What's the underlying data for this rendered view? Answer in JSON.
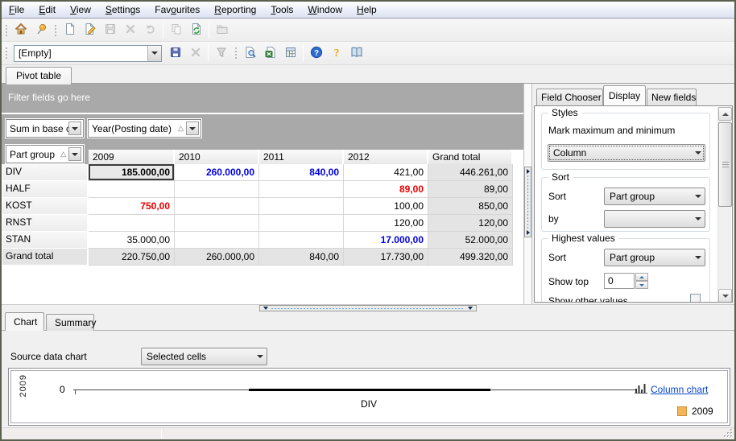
{
  "main_tab_label": "Pivot table",
  "menu": {
    "items": [
      {
        "label": "File",
        "accel": 0
      },
      {
        "label": "Edit",
        "accel": 0
      },
      {
        "label": "View",
        "accel": 0
      },
      {
        "label": "Settings",
        "accel": 0
      },
      {
        "label": "Favourites",
        "accel": 3
      },
      {
        "label": "Reporting",
        "accel": 0
      },
      {
        "label": "Tools",
        "accel": 0
      },
      {
        "label": "Window",
        "accel": 0
      },
      {
        "label": "Help",
        "accel": 0
      }
    ]
  },
  "toolbar_main": {
    "items": [
      {
        "type": "grip"
      },
      {
        "type": "button",
        "icon": "home",
        "enabled": true
      },
      {
        "type": "button",
        "icon": "pin",
        "enabled": true
      },
      {
        "type": "grip"
      },
      {
        "type": "button",
        "icon": "new-document",
        "enabled": true
      },
      {
        "type": "button",
        "icon": "edit-document",
        "enabled": true
      },
      {
        "type": "button",
        "icon": "save",
        "enabled": false
      },
      {
        "type": "button",
        "icon": "delete",
        "enabled": false
      },
      {
        "type": "button",
        "icon": "undo",
        "enabled": false
      },
      {
        "type": "sep"
      },
      {
        "type": "button",
        "icon": "copy",
        "enabled": false
      },
      {
        "type": "button",
        "icon": "refresh",
        "enabled": true
      },
      {
        "type": "sep"
      },
      {
        "type": "button",
        "icon": "folder",
        "enabled": false
      }
    ]
  },
  "toolbar_view": {
    "combo_value": "[Empty]",
    "items": [
      {
        "type": "grip"
      },
      {
        "type": "combo"
      },
      {
        "type": "button",
        "icon": "save",
        "enabled": true
      },
      {
        "type": "button",
        "icon": "delete",
        "enabled": false
      },
      {
        "type": "sep"
      },
      {
        "type": "button",
        "icon": "filter",
        "enabled": false
      },
      {
        "type": "grip"
      },
      {
        "type": "button",
        "icon": "print-preview",
        "enabled": true
      },
      {
        "type": "button",
        "icon": "export-excel",
        "enabled": true
      },
      {
        "type": "button",
        "icon": "pivot-grid",
        "enabled": true
      },
      {
        "type": "sep"
      },
      {
        "type": "button",
        "icon": "help",
        "enabled": true
      },
      {
        "type": "button",
        "icon": "context-help",
        "enabled": true
      },
      {
        "type": "button",
        "icon": "manual",
        "enabled": true
      }
    ]
  },
  "pivot": {
    "filter_hint": "Filter fields go here",
    "data_field": "Sum in base cu",
    "column_field": "Year(Posting date)",
    "row_field": "Part group",
    "columns": [
      "2009",
      "2010",
      "2011",
      "2012",
      "Grand total"
    ],
    "rows": [
      {
        "label": "DIV",
        "cells": [
          {
            "text": "185.000,00",
            "style": "selected"
          },
          {
            "text": "260.000,00",
            "style": "max"
          },
          {
            "text": "840,00",
            "style": "max"
          },
          {
            "text": "421,00",
            "style": ""
          },
          {
            "text": "446.261,00",
            "style": ""
          }
        ]
      },
      {
        "label": "HALF",
        "cells": [
          {
            "text": "",
            "style": ""
          },
          {
            "text": "",
            "style": ""
          },
          {
            "text": "",
            "style": ""
          },
          {
            "text": "89,00",
            "style": "min"
          },
          {
            "text": "89,00",
            "style": ""
          }
        ]
      },
      {
        "label": "KOST",
        "cells": [
          {
            "text": "750,00",
            "style": "min"
          },
          {
            "text": "",
            "style": ""
          },
          {
            "text": "",
            "style": ""
          },
          {
            "text": "100,00",
            "style": ""
          },
          {
            "text": "850,00",
            "style": ""
          }
        ]
      },
      {
        "label": "RNST",
        "cells": [
          {
            "text": "",
            "style": ""
          },
          {
            "text": "",
            "style": ""
          },
          {
            "text": "",
            "style": ""
          },
          {
            "text": "120,00",
            "style": ""
          },
          {
            "text": "120,00",
            "style": ""
          }
        ]
      },
      {
        "label": "STAN",
        "cells": [
          {
            "text": "35.000,00",
            "style": ""
          },
          {
            "text": "",
            "style": ""
          },
          {
            "text": "",
            "style": ""
          },
          {
            "text": "17.000,00",
            "style": "max"
          },
          {
            "text": "52.000,00",
            "style": ""
          }
        ]
      },
      {
        "label": "Grand total",
        "is_total": true,
        "cells": [
          {
            "text": "220.750,00",
            "style": ""
          },
          {
            "text": "260.000,00",
            "style": ""
          },
          {
            "text": "840,00",
            "style": ""
          },
          {
            "text": "17.730,00",
            "style": ""
          },
          {
            "text": "499.320,00",
            "style": ""
          }
        ]
      }
    ]
  },
  "field_panel": {
    "tabs": [
      "Field Chooser",
      "Display",
      "New fields"
    ],
    "active_tab": "Display",
    "styles_group": {
      "title": "Styles",
      "mark_label": "Mark maximum and minimum",
      "combo_value": "Column"
    },
    "sort_group": {
      "title": "Sort",
      "sort_label": "Sort",
      "sort_value": "Part group",
      "by_label": "by",
      "by_value": ""
    },
    "highest_group": {
      "title": "Highest values",
      "sort_label": "Sort",
      "sort_value": "Part group",
      "show_top_label": "Show top",
      "show_top_value": "0",
      "show_other_label": "Show other values"
    }
  },
  "bottom_panel": {
    "tabs": [
      "Chart",
      "Summary"
    ],
    "active_tab": "Chart",
    "source_label": "Source data chart",
    "source_value": "Selected cells",
    "column_chart_link": "Column chart",
    "legend": {
      "label": "2009",
      "color": "#f5b45a"
    },
    "axis_series_label": "2009",
    "axis_zero_label": "0",
    "category_label": "DIV"
  },
  "chart_data": {
    "type": "bar",
    "categories": [
      "DIV"
    ],
    "series": [
      {
        "name": "2009",
        "values": [
          0
        ]
      }
    ],
    "title": "",
    "xlabel": "",
    "ylabel": "2009",
    "legend_position": "right",
    "y_ticks": [
      0
    ]
  }
}
